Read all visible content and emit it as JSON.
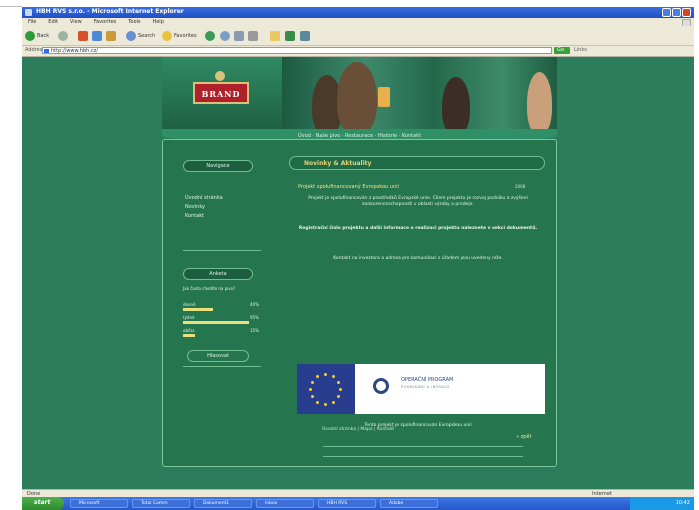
{
  "browser": {
    "title": "HBH RVS s.r.o. - Microsoft Internet Explorer",
    "menu": [
      "File",
      "Edit",
      "View",
      "Favorites",
      "Tools",
      "Help"
    ],
    "toolbar": {
      "back": "Back",
      "search": "Search",
      "favorites": "Favorites"
    },
    "address_label": "Address",
    "url": "http://www.hbh.cz/",
    "go_label": "Go",
    "links_label": "Links"
  },
  "site": {
    "logo_text": "BRAND",
    "nav_text": "Úvod · Naše pivo · Restaurace · Historie · Kontakt",
    "sidebar": {
      "box1_title": "Navigace",
      "links": [
        "Úvodní stránka",
        "Novinky",
        "Kontakt"
      ],
      "poll_title": "Anketa",
      "poll_question": "Jak často chodíte na pivo?",
      "poll_options": [
        {
          "label": "denně",
          "pct": "40%",
          "value": 40
        },
        {
          "label": "týdně",
          "pct": "95%",
          "value": 95
        },
        {
          "label": "občas",
          "pct": "15%",
          "value": 15
        }
      ],
      "poll_button": "Hlasovat"
    },
    "main": {
      "header": "Novinky & Aktuality",
      "headline": "Projekt spolufinancovaný Evropskou unií",
      "date": "2008",
      "para1": "Projekt je spolufinancován z prostředků Evropské unie. Cílem projektu je rozvoj podniku a zvýšení konkurenceschopnosti v oblasti výroby a prodeje.",
      "para2": "Registrační číslo projektu a další informace o realizaci projektu naleznete v sekci dokumentů.",
      "para3": "Kontakt na investora a adresa pro komunikaci s úřadem jsou uvedeny níže.",
      "eu_text": "OPERAČNÍ PROGRAM",
      "eu_sub": "PODNIKÁNÍ A INOVACE",
      "funded": "Tento projekt je spolufinancován Evropskou unií",
      "back": "« zpět",
      "footer": "Úvodní stránka | Mapa | Kontakt"
    }
  },
  "status": {
    "text": "Done",
    "zone": "Internet"
  },
  "taskbar": {
    "start": "start",
    "tasks": [
      "Microsoft",
      "Total Comm",
      "Dokument1",
      "Inbox",
      "HBH RVS",
      "Adobe"
    ],
    "clock": "10:42"
  }
}
